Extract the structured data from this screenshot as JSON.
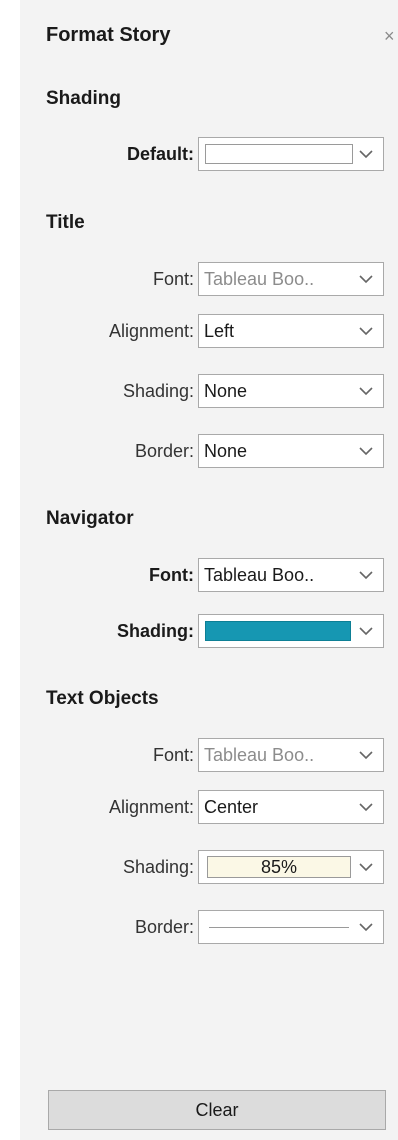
{
  "header": {
    "title": "Format Story",
    "close_glyph": "×"
  },
  "shading_section": {
    "title": "Shading",
    "default": {
      "label": "Default:",
      "swatch_color": "#ffffff"
    }
  },
  "title_section": {
    "title": "Title",
    "font": {
      "label": "Font:",
      "value": "Tableau Boo.."
    },
    "alignment": {
      "label": "Alignment:",
      "value": "Left"
    },
    "shading": {
      "label": "Shading:",
      "value": "None"
    },
    "border": {
      "label": "Border:",
      "value": "None"
    }
  },
  "navigator_section": {
    "title": "Navigator",
    "font": {
      "label": "Font:",
      "value": "Tableau Boo.."
    },
    "shading": {
      "label": "Shading:",
      "swatch_color": "#1697b2"
    }
  },
  "text_objects_section": {
    "title": "Text Objects",
    "font": {
      "label": "Font:",
      "value": "Tableau Boo.."
    },
    "alignment": {
      "label": "Alignment:",
      "value": "Center"
    },
    "shading": {
      "label": "Shading:",
      "value": "85%",
      "swatch_color": "#fbf8e6"
    },
    "border": {
      "label": "Border:"
    }
  },
  "footer": {
    "clear_label": "Clear"
  },
  "icons": {
    "dropdown": "chevron-down-icon",
    "close": "close-icon"
  }
}
